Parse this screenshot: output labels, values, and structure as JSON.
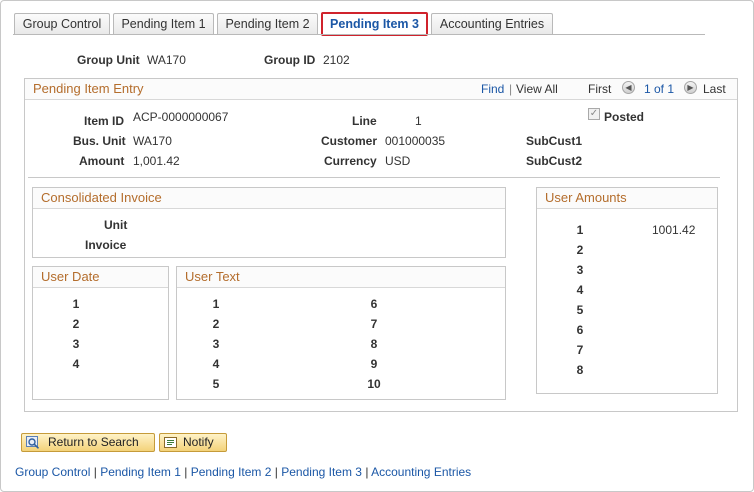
{
  "tabs": [
    {
      "label": "Group Control"
    },
    {
      "label": "Pending Item 1"
    },
    {
      "label": "Pending Item 2"
    },
    {
      "label": "Pending Item 3"
    },
    {
      "label": "Accounting Entries"
    }
  ],
  "group": {
    "unit_label": "Group Unit",
    "unit_value": "WA170",
    "id_label": "Group ID",
    "id_value": "2102"
  },
  "pending_entry": {
    "title": "Pending Item Entry",
    "find": "Find",
    "separator": "|",
    "view_all": "View All",
    "first": "First",
    "pager": "1 of 1",
    "last": "Last",
    "item_id_label": "Item ID",
    "item_id": "ACP-0000000067",
    "line_label": "Line",
    "line": "1",
    "posted_label": "Posted",
    "posted_checked": true,
    "bus_unit_label": "Bus. Unit",
    "bus_unit": "WA170",
    "customer_label": "Customer",
    "customer": "001000035",
    "subcust1_label": "SubCust1",
    "amount_label": "Amount",
    "amount": "1,001.42",
    "currency_label": "Currency",
    "currency": "USD",
    "subcust2_label": "SubCust2"
  },
  "consolidated_invoice": {
    "title": "Consolidated Invoice",
    "unit_label": "Unit",
    "invoice_label": "Invoice"
  },
  "user_amounts": {
    "title": "User Amounts",
    "rows": [
      "1",
      "2",
      "3",
      "4",
      "5",
      "6",
      "7",
      "8"
    ],
    "value_1": "1001.42"
  },
  "user_date": {
    "title": "User Date",
    "rows": [
      "1",
      "2",
      "3",
      "4"
    ]
  },
  "user_text": {
    "title": "User Text",
    "col1": [
      "1",
      "2",
      "3",
      "4",
      "5"
    ],
    "col2": [
      "6",
      "7",
      "8",
      "9",
      "10"
    ]
  },
  "buttons": {
    "return": "Return to Search",
    "notify": "Notify"
  },
  "footer_links": {
    "group_control": "Group Control",
    "pending1": "Pending Item 1",
    "pending2": "Pending Item 2",
    "pending3": "Pending Item 3",
    "accounting": "Accounting Entries",
    "sep": "|"
  },
  "colors": {
    "section_title": "#b46d2c",
    "link": "#1b57a6",
    "active_tab_border": "#d0232c"
  }
}
